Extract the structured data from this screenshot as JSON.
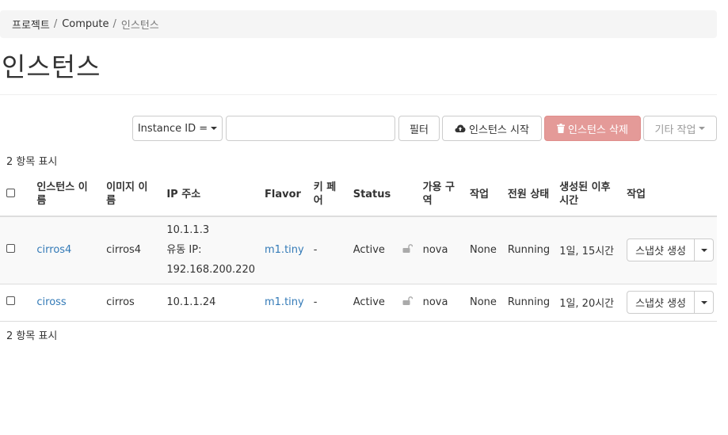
{
  "breadcrumb": {
    "items": [
      "프로젝트",
      "Compute",
      "인스턴스"
    ],
    "separator": "/"
  },
  "page": {
    "title": "인스턴스"
  },
  "toolbar": {
    "filter_select_label": "Instance ID =",
    "filter_input_value": "",
    "filter_button": "필터",
    "launch_button": "인스턴스 시작",
    "delete_button": "인스턴스 삭제",
    "more_button": "기타 작업"
  },
  "summary": {
    "top": "2 항목 표시",
    "bottom": "2 항목 표시"
  },
  "table": {
    "headers": {
      "name": "인스턴스 이름",
      "image": "이미지 이름",
      "ip": "IP 주소",
      "flavor": "Flavor",
      "keypair": "키 페어",
      "status": "Status",
      "az": "가용 구역",
      "task": "작업",
      "power": "전원 상태",
      "age": "생성된 이후 시간",
      "actions": "작업"
    },
    "rows": [
      {
        "name": "cirros4",
        "image": "cirros4",
        "ip_lines": [
          "10.1.1.3",
          "유동 IP:",
          "192.168.200.220"
        ],
        "flavor": "m1.tiny",
        "keypair": "-",
        "status": "Active",
        "az": "nova",
        "task": "None",
        "power": "Running",
        "age": "1일, 15시간",
        "action": "스냅샷 생성"
      },
      {
        "name": "ciross",
        "image": "cirros",
        "ip_lines": [
          "10.1.1.24"
        ],
        "flavor": "m1.tiny",
        "keypair": "-",
        "status": "Active",
        "az": "nova",
        "task": "None",
        "power": "Running",
        "age": "1일, 20시간",
        "action": "스냅샷 생성"
      }
    ]
  },
  "colors": {
    "link": "#337ab7",
    "danger_button": "#e49a98",
    "breadcrumb_bg": "#f5f5f5"
  }
}
